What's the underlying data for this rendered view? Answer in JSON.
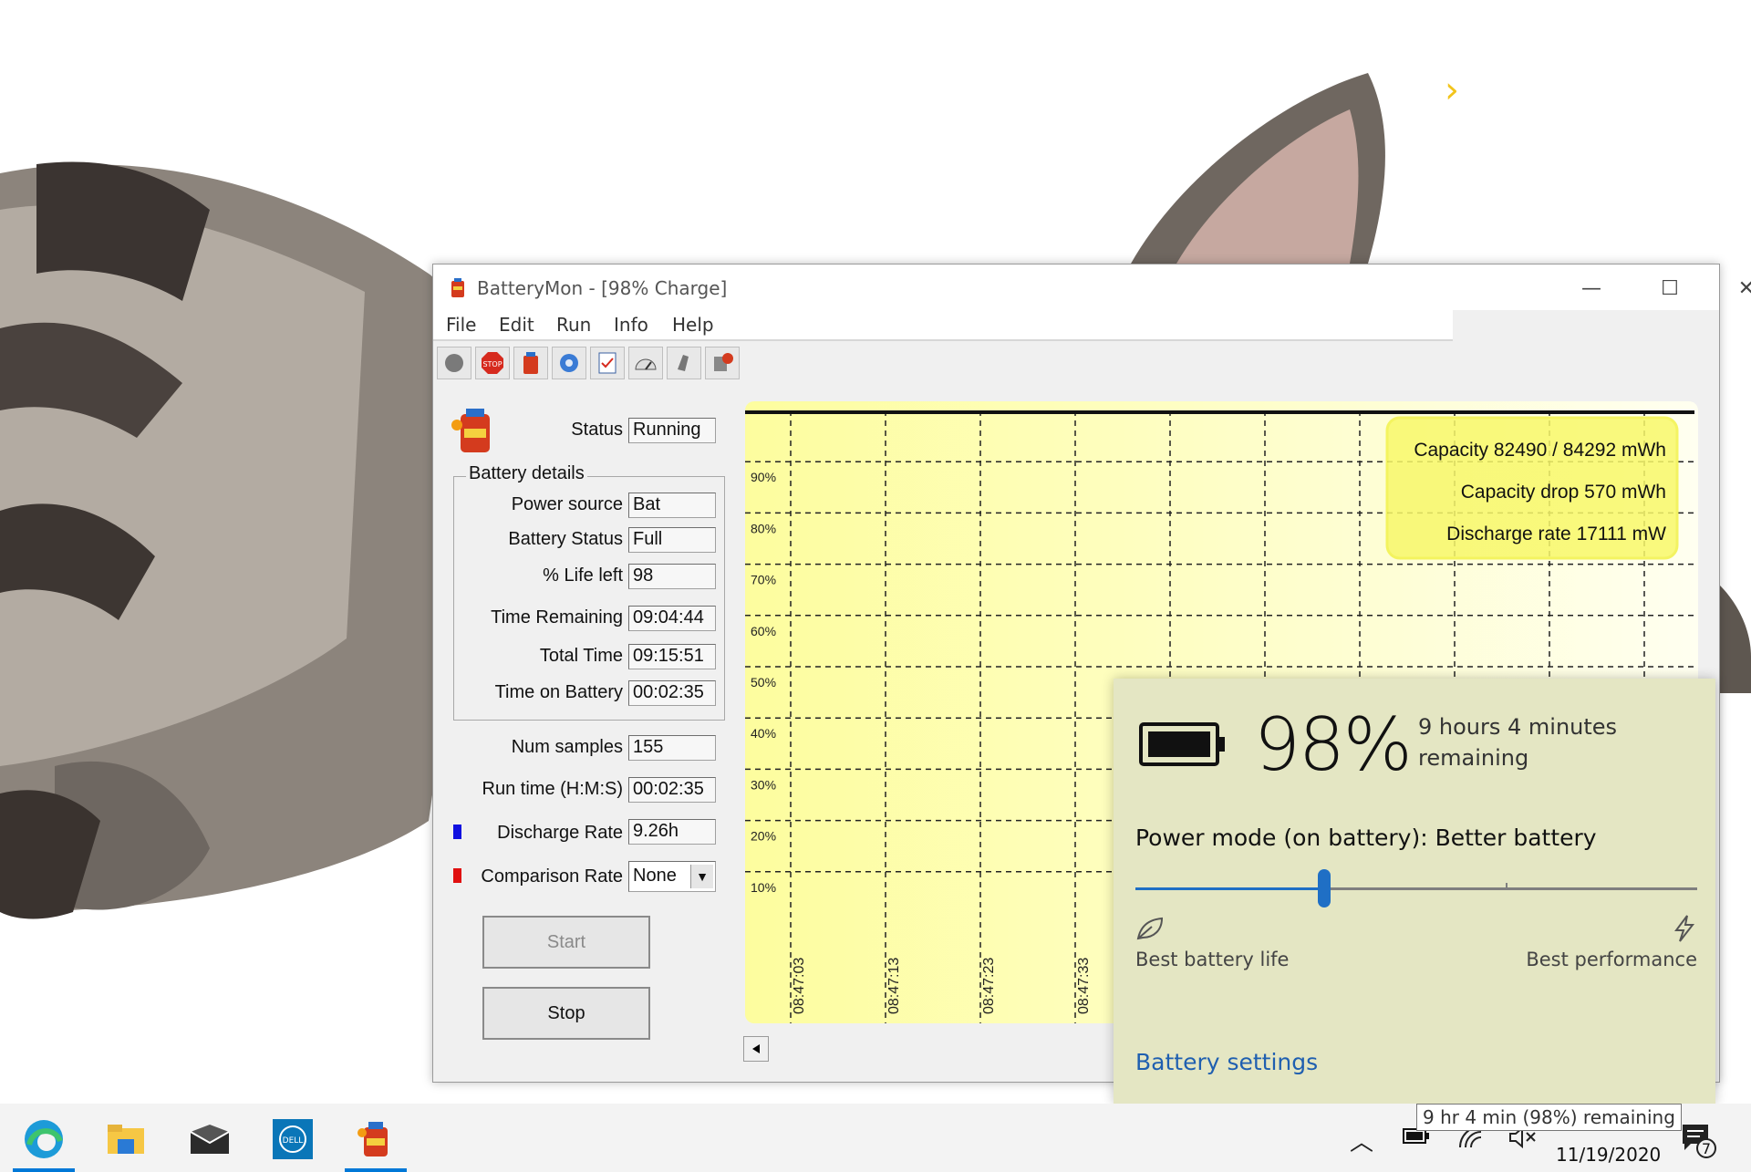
{
  "window": {
    "title": "BatteryMon - [98% Charge]",
    "menu": [
      "File",
      "Edit",
      "Run",
      "Info",
      "Help"
    ],
    "controls": {
      "minimize": "—",
      "maximize": "☐",
      "close": "✕"
    }
  },
  "toolbar": {
    "icons": [
      "record-icon",
      "stop-icon",
      "battery-icon",
      "settings-icon",
      "checklist-icon",
      "gauge-icon",
      "sound-icon",
      "info-icon"
    ]
  },
  "panel": {
    "status_label": "Status",
    "status_value": "Running",
    "group_title": "Battery details",
    "power_source_label": "Power source",
    "power_source_value": "Bat",
    "battery_status_label": "Battery Status",
    "battery_status_value": "Full",
    "life_left_label": "% Life left",
    "life_left_value": "98",
    "time_remaining_label": "Time Remaining",
    "time_remaining_value": "09:04:44",
    "total_time_label": "Total Time",
    "total_time_value": "09:15:51",
    "time_on_battery_label": "Time on Battery",
    "time_on_battery_value": "00:02:35",
    "num_samples_label": "Num samples",
    "num_samples_value": "155",
    "run_time_label": "Run time (H:M:S)",
    "run_time_value": "00:02:35",
    "discharge_rate_label": "Discharge Rate",
    "discharge_rate_value": "9.26h",
    "discharge_color": "#1010e0",
    "comparison_rate_label": "Comparison Rate",
    "comparison_rate_value": "None",
    "comparison_color": "#e01010",
    "start_label": "Start",
    "stop_label": "Stop"
  },
  "chart_data": {
    "type": "line",
    "y_ticks": [
      "90%",
      "80%",
      "70%",
      "60%",
      "50%",
      "40%",
      "30%",
      "20%",
      "10%"
    ],
    "x_ticks": [
      "08:47:03",
      "08:47:13",
      "08:47:23",
      "08:47:33"
    ],
    "series": [
      {
        "values": [
          98,
          98,
          98,
          98,
          98,
          98,
          98,
          98,
          98,
          98
        ]
      }
    ],
    "info_lines": [
      "Capacity 82490 / 84292 mWh",
      "Capacity drop 570 mWh",
      "Discharge rate 17111 mW"
    ],
    "grid": true,
    "background": "#fdfdc0"
  },
  "flyout": {
    "percent": "98%",
    "remaining": "9 hours 4 minutes remaining",
    "mode": "Power mode (on battery): Better battery",
    "slider_position": 0.33,
    "left_label": "Best battery life",
    "right_label": "Best performance",
    "settings_link": "Battery settings",
    "accent": "#1f6fc5"
  },
  "taskbar": {
    "apps": [
      "edge-icon",
      "file-explorer-icon",
      "mail-icon",
      "dell-icon",
      "batterymon-icon"
    ],
    "tooltip": "9 hr 4 min (98%) remaining",
    "date": "11/19/2020",
    "notification_count": "7"
  }
}
